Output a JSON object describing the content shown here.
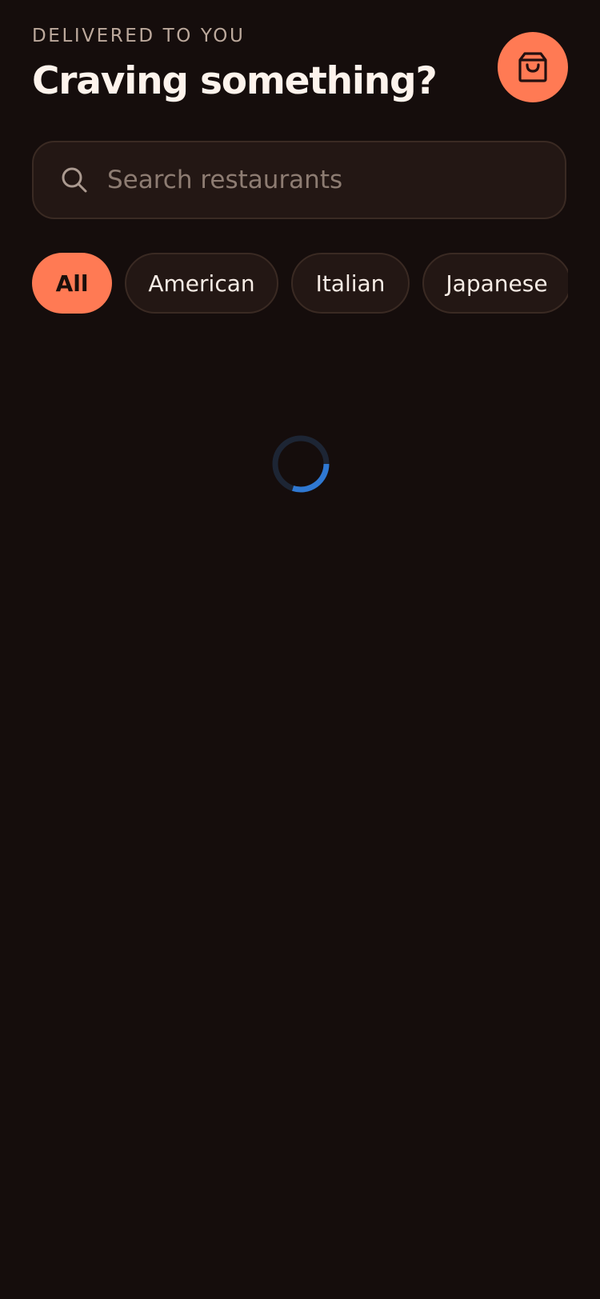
{
  "header": {
    "eyebrow": "DELIVERED TO YOU",
    "title": "Craving something?"
  },
  "cart": {
    "icon": "shopping-bag-icon"
  },
  "search": {
    "icon": "search-icon",
    "placeholder": "Search restaurants",
    "value": ""
  },
  "filters": [
    {
      "label": "All",
      "active": true
    },
    {
      "label": "American",
      "active": false
    },
    {
      "label": "Italian",
      "active": false
    },
    {
      "label": "Japanese",
      "active": false
    }
  ],
  "colors": {
    "background": "#150d0c",
    "accent": "#ff7a54",
    "surface": "#231714",
    "spinner": "#2f78d2"
  },
  "loading": {
    "indicator": "spinner",
    "progress": 0.3
  }
}
